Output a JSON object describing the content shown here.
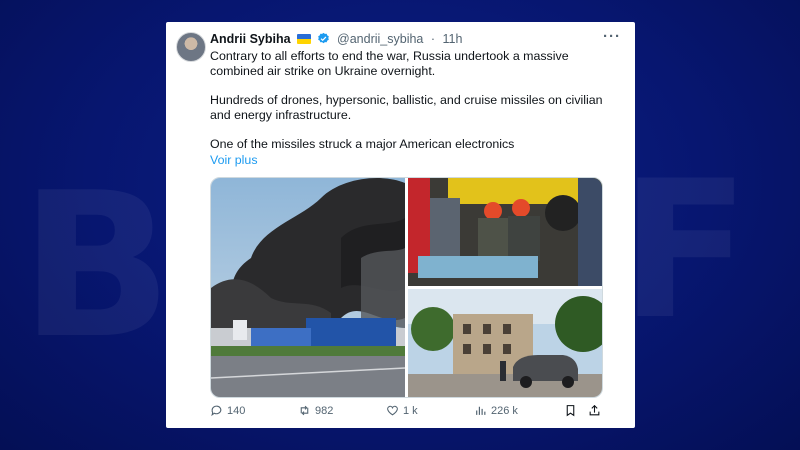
{
  "tweet": {
    "author_name": "Andrii Sybiha",
    "handle": "@andrii_sybiha",
    "time_sep": "·",
    "time": "11h",
    "paragraphs": [
      "Contrary to all efforts to end the war, Russia undertook a massive combined air strike on Ukraine overnight.",
      "Hundreds of drones, hypersonic, ballistic, and cruise missiles on civilian and energy infrastructure.",
      "One of the missiles struck a major American electronics"
    ],
    "see_more": "Voir plus"
  },
  "actions": {
    "replies": "140",
    "reposts": "982",
    "likes": "1 k",
    "views": "226 k"
  },
  "icons": {
    "verified": "verified-badge-icon",
    "flag": "ukraine-flag-icon",
    "more": "more-options-icon",
    "reply": "reply-icon",
    "repost": "repost-icon",
    "like": "heart-icon",
    "views": "views-chart-icon",
    "bookmark": "bookmark-icon",
    "share": "share-icon"
  },
  "colors": {
    "accent": "#1d9bf0",
    "verified": "#1d9bf0",
    "text": "#0f1419",
    "muted": "#536471",
    "background": "#071670"
  }
}
